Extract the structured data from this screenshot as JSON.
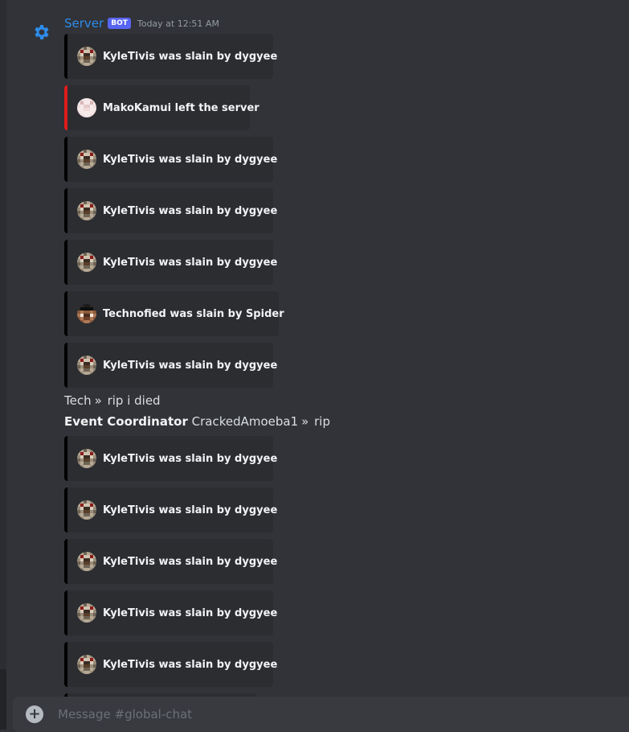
{
  "message": {
    "author": "Server",
    "bot_tag": "BOT",
    "timestamp": "Today at 12:51 AM",
    "avatar_icon": "gear-icon",
    "author_color": "#2d8ceb"
  },
  "embeds_top": [
    {
      "text": "KyleTivis was slain by dygyee",
      "skin": "kyle",
      "accent": "#000000"
    },
    {
      "text": "MakoKamui left the server",
      "skin": "mako",
      "accent": "#e01b1b"
    },
    {
      "text": "KyleTivis was slain by dygyee",
      "skin": "kyle",
      "accent": "#000000"
    },
    {
      "text": "KyleTivis was slain by dygyee",
      "skin": "kyle",
      "accent": "#000000"
    },
    {
      "text": "KyleTivis was slain by dygyee",
      "skin": "kyle",
      "accent": "#000000"
    },
    {
      "text": "Technofied was slain by Spider",
      "skin": "techno",
      "accent": "#000000"
    },
    {
      "text": "KyleTivis was slain by dygyee",
      "skin": "kyle",
      "accent": "#000000"
    }
  ],
  "chat_lines": [
    {
      "role": "",
      "name": "Tech",
      "separator": "»",
      "text": "rip i died"
    },
    {
      "role": "Event Coordinator",
      "name": "CrackedAmoeba1",
      "separator": "»",
      "text": "rip"
    }
  ],
  "embeds_bottom": [
    {
      "text": "KyleTivis was slain by dygyee",
      "skin": "kyle",
      "accent": "#000000"
    },
    {
      "text": "KyleTivis was slain by dygyee",
      "skin": "kyle",
      "accent": "#000000"
    },
    {
      "text": "KyleTivis was slain by dygyee",
      "skin": "kyle",
      "accent": "#000000"
    },
    {
      "text": "KyleTivis was slain by dygyee",
      "skin": "kyle",
      "accent": "#000000"
    },
    {
      "text": "KyleTivis was slain by dygyee",
      "skin": "kyle",
      "accent": "#000000"
    }
  ],
  "composer": {
    "placeholder": "Message #global-chat",
    "attach_icon": "plus-circle-icon"
  }
}
